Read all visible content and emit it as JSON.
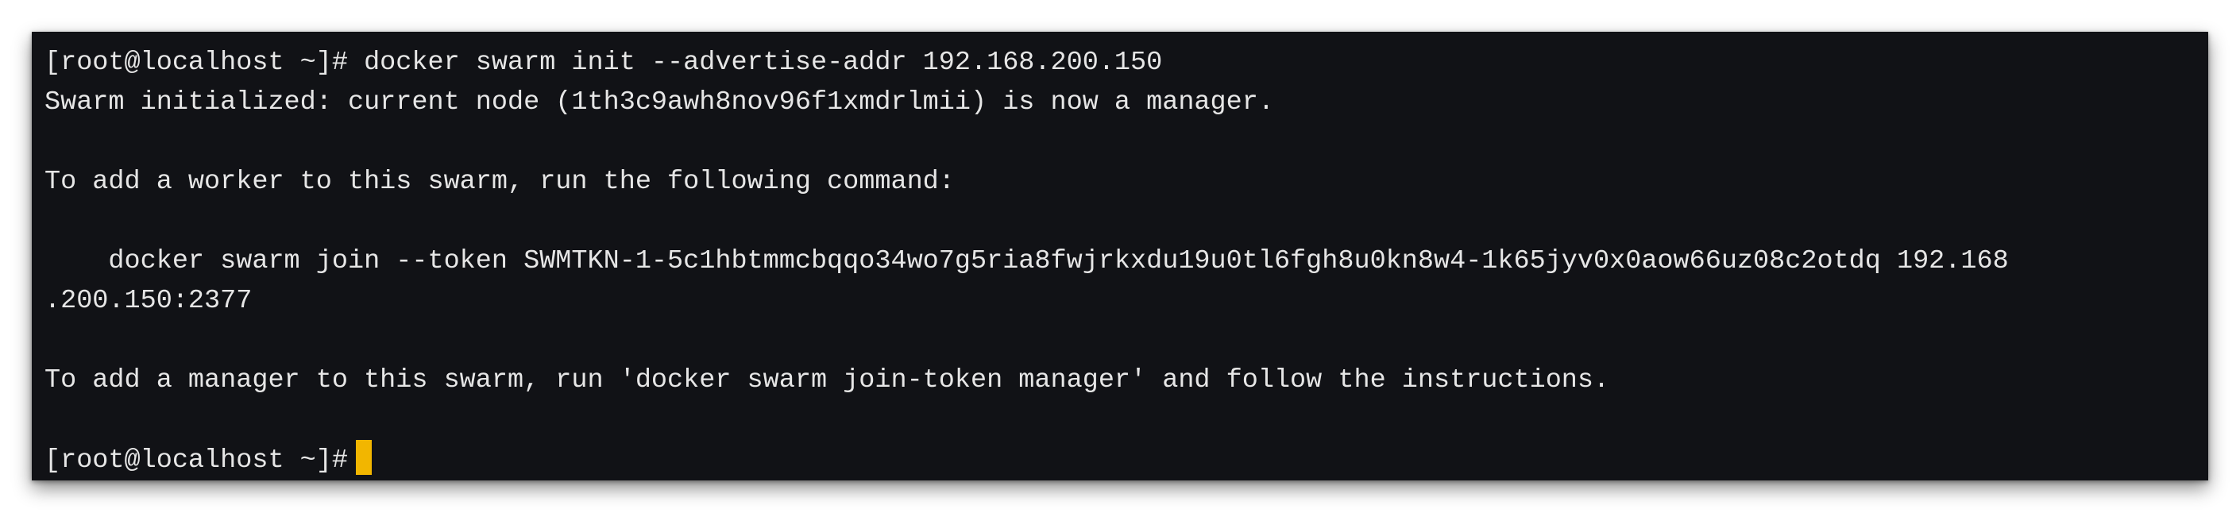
{
  "terminal": {
    "lines": [
      {
        "prompt": "[root@localhost ~]#",
        "text": " docker swarm init --advertise-addr 192.168.200.150"
      },
      {
        "text": "Swarm initialized: current node (1th3c9awh8nov96f1xmdrlmii) is now a manager."
      },
      {
        "text": ""
      },
      {
        "text": "To add a worker to this swarm, run the following command:"
      },
      {
        "text": ""
      },
      {
        "text": "    docker swarm join --token SWMTKN-1-5c1hbtmmcbqqo34wo7g5ria8fwjrkxdu19u0tl6fgh8u0kn8w4-1k65jyv0x0aow66uz08c2otdq 192.168"
      },
      {
        "text": ".200.150:2377"
      },
      {
        "text": ""
      },
      {
        "text": "To add a manager to this swarm, run 'docker swarm join-token manager' and follow the instructions."
      },
      {
        "text": ""
      },
      {
        "prompt": "[root@localhost ~]#",
        "text": ""
      }
    ]
  },
  "colors": {
    "background": "#111216",
    "text": "#e6e6e6",
    "cursor": "#f2b600"
  }
}
